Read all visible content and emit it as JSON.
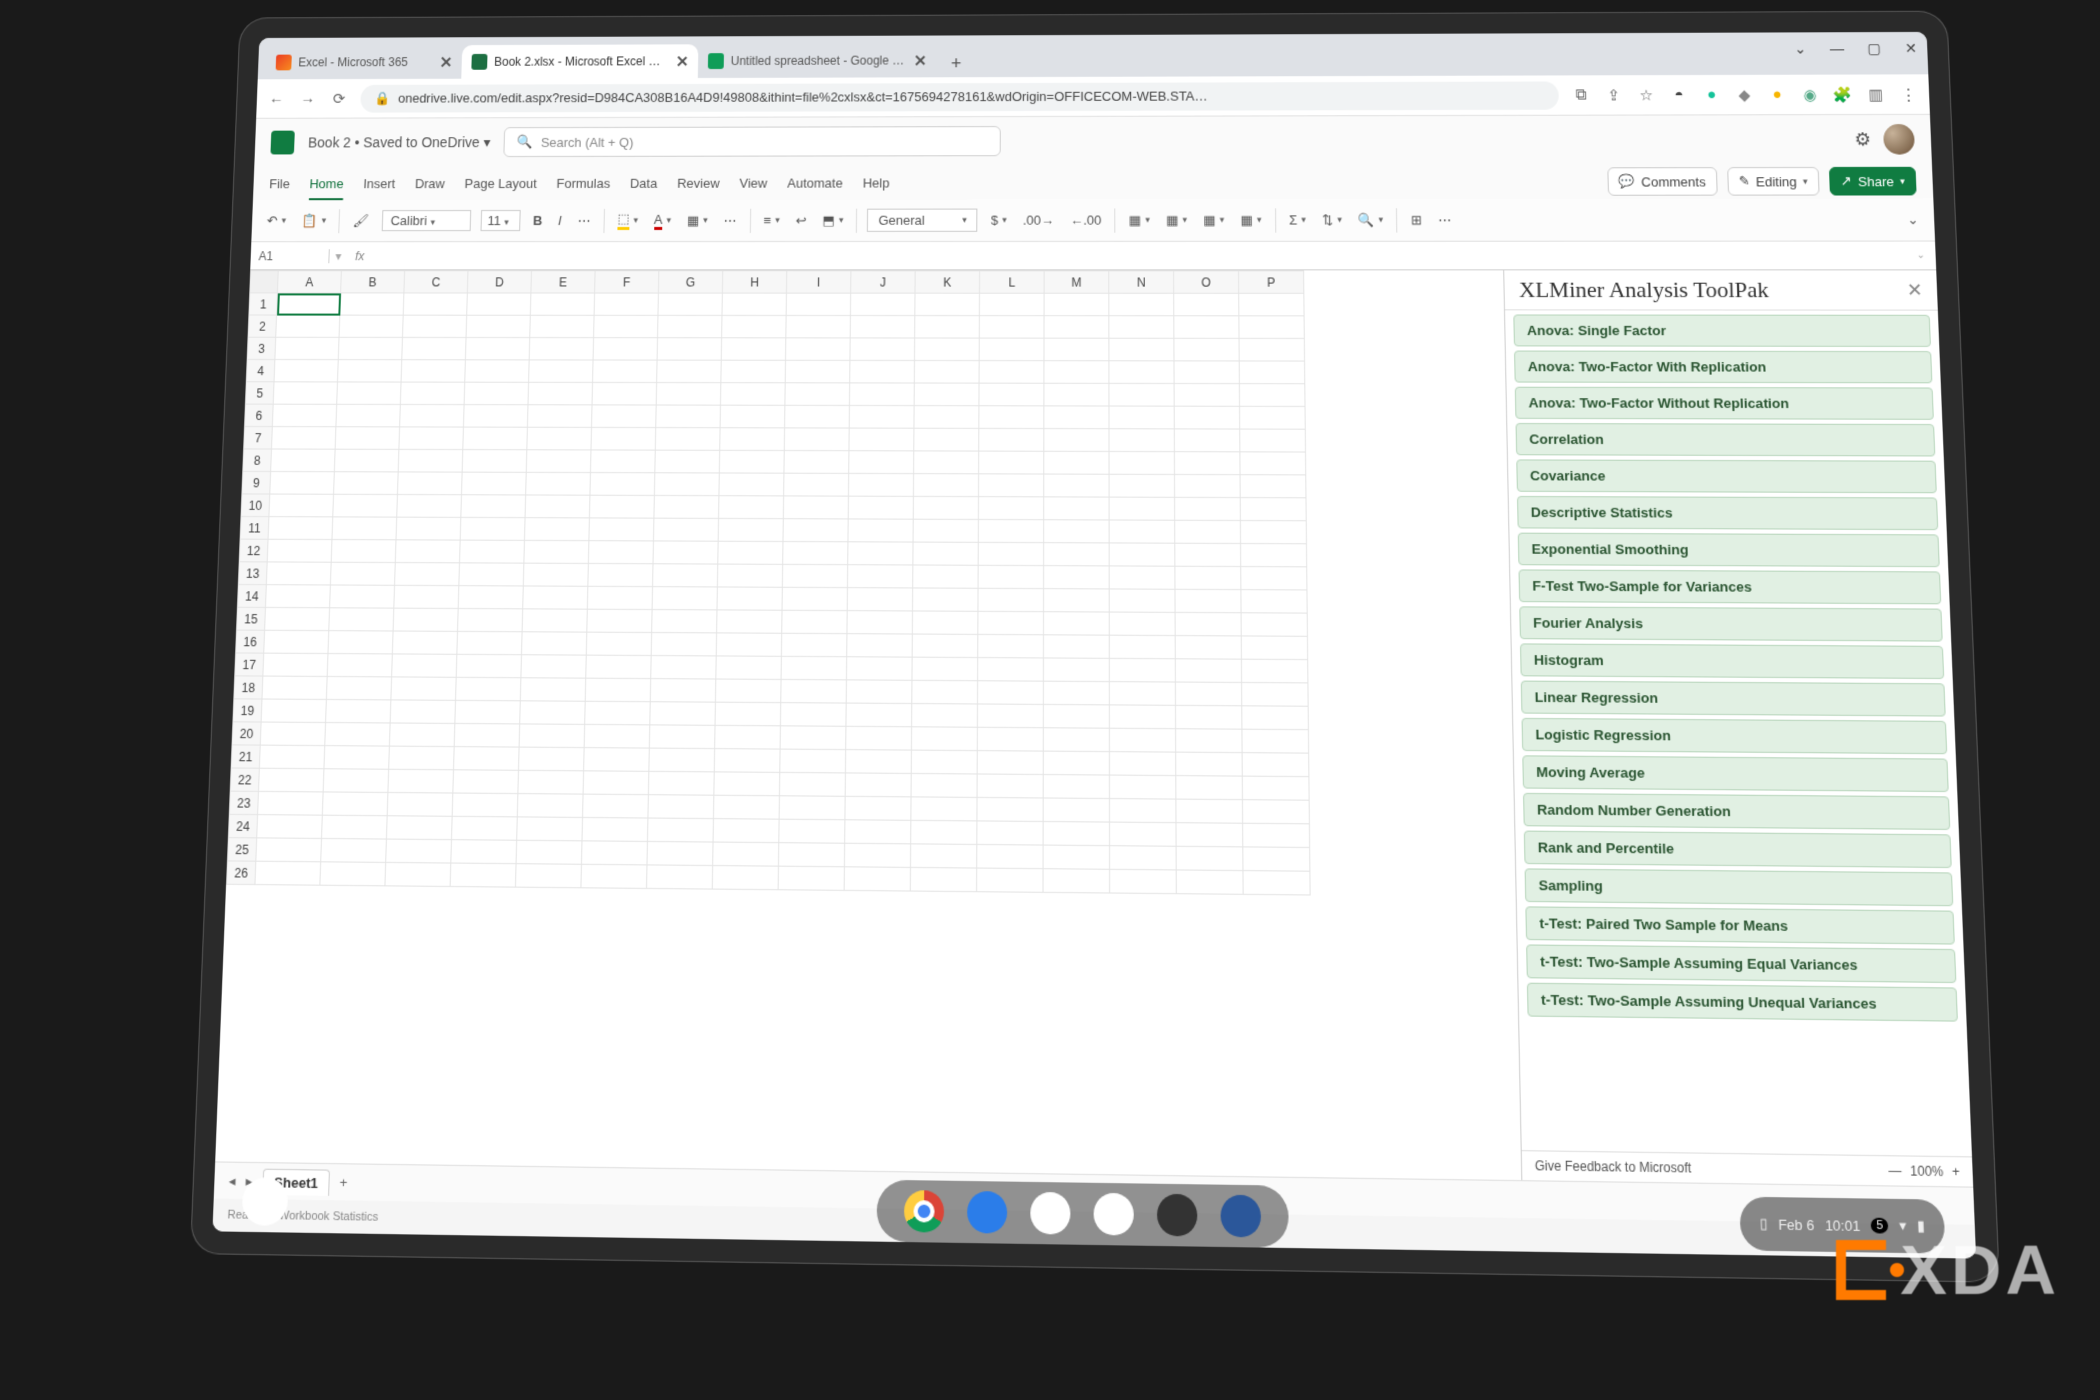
{
  "browser": {
    "tabs": [
      {
        "title": "Excel - Microsoft 365",
        "active": false,
        "favicon": "office"
      },
      {
        "title": "Book 2.xlsx - Microsoft Excel O…",
        "active": true,
        "favicon": "excel"
      },
      {
        "title": "Untitled spreadsheet - Google Sh…",
        "active": false,
        "favicon": "sheets"
      }
    ],
    "url": "onedrive.live.com/edit.aspx?resid=D984CA308B16A4D9!49808&ithint=file%2cxlsx&ct=1675694278161&wdOrigin=OFFICECOM-WEB.STA…"
  },
  "excel": {
    "doc_title": "Book 2 • Saved to OneDrive ▾",
    "search_placeholder": "Search (Alt + Q)",
    "menu": [
      "File",
      "Home",
      "Insert",
      "Draw",
      "Page Layout",
      "Formulas",
      "Data",
      "Review",
      "View",
      "Automate",
      "Help"
    ],
    "active_menu": "Home",
    "buttons": {
      "comments": "Comments",
      "editing": "Editing",
      "share": "Share"
    },
    "toolbar": {
      "font": "Calibri",
      "size": "11",
      "format": "General"
    },
    "formula": {
      "namebox": "A1",
      "fx": "fx",
      "value": ""
    },
    "columns": [
      "A",
      "B",
      "C",
      "D",
      "E",
      "F",
      "G",
      "H",
      "I",
      "J",
      "K",
      "L",
      "M",
      "N",
      "O",
      "P"
    ],
    "rows_count": 26,
    "selected_cell": "A1",
    "sheet": {
      "name": "Sheet1"
    },
    "status": {
      "ready": "Ready",
      "access": "Workbook Statistics"
    }
  },
  "pane": {
    "title": "XLMiner Analysis ToolPak",
    "tools": [
      "Anova: Single Factor",
      "Anova: Two-Factor With Replication",
      "Anova: Two-Factor Without Replication",
      "Correlation",
      "Covariance",
      "Descriptive Statistics",
      "Exponential Smoothing",
      "F-Test Two-Sample for Variances",
      "Fourier Analysis",
      "Histogram",
      "Linear Regression",
      "Logistic Regression",
      "Moving Average",
      "Random Number Generation",
      "Rank and Percentile",
      "Sampling",
      "t-Test: Paired Two Sample for Means",
      "t-Test: Two-Sample Assuming Equal Variances",
      "t-Test: Two-Sample Assuming Unequal Variances"
    ],
    "feedback": "Give Feedback to Microsoft",
    "zoom": "100%"
  },
  "tray": {
    "date": "Feb 6",
    "time": "10:01"
  },
  "watermark": "XDA"
}
